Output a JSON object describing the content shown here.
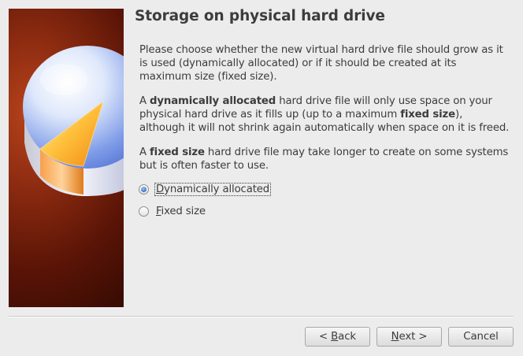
{
  "dialog": {
    "title": "Storage on physical hard drive",
    "paragraphs": {
      "p1": "Please choose whether the new virtual hard drive file should grow as it is used (dynamically allocated) or if it should be created at its maximum size (fixed size).",
      "p2_a": "A ",
      "p2_b": "dynamically allocated",
      "p2_c": " hard drive file will only use space on your physical hard drive as it fills up (up to a maximum ",
      "p2_d": "fixed size",
      "p2_e": "), although it will not shrink again automatically when space on it is freed.",
      "p3_a": "A ",
      "p3_b": "fixed size",
      "p3_c": " hard drive file may take longer to create on some systems but is often faster to use."
    },
    "options": {
      "dynamic": {
        "mnemonic": "D",
        "rest": "ynamically allocated",
        "checked": true
      },
      "fixed": {
        "mnemonic": "F",
        "rest": "ixed size",
        "checked": false
      }
    },
    "buttons": {
      "back_prefix": "< ",
      "back_mnemonic": "B",
      "back_rest": "ack",
      "next_mnemonic": "N",
      "next_rest": "ext >",
      "cancel": "Cancel"
    }
  },
  "icons": {
    "side_image": "pie-chart-disk-image"
  }
}
